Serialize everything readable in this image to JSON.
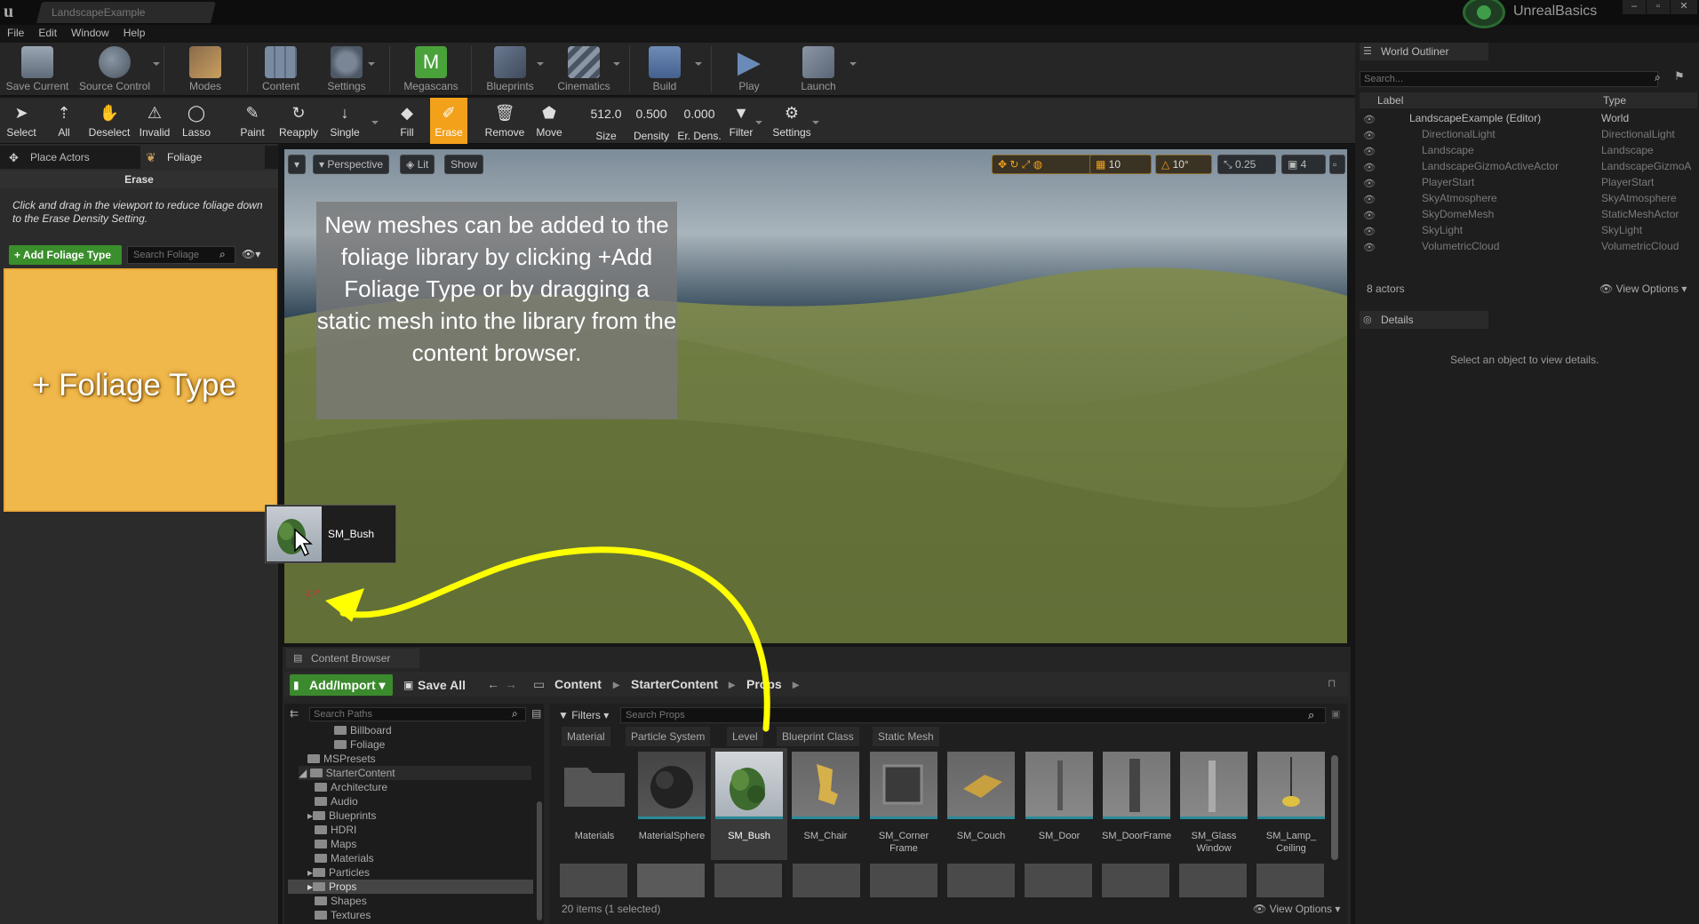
{
  "window": {
    "tab_title": "LandscapeExample",
    "project_name": "UnrealBasics"
  },
  "menu": [
    "File",
    "Edit",
    "Window",
    "Help"
  ],
  "main_toolbar": [
    {
      "label": "Save Current",
      "icon": "save-icon"
    },
    {
      "label": "Source Control",
      "icon": "source-control-icon"
    },
    {
      "label": "Modes",
      "icon": "modes-icon"
    },
    {
      "label": "Content",
      "icon": "content-icon"
    },
    {
      "label": "Settings",
      "icon": "settings-icon"
    },
    {
      "label": "Megascans",
      "icon": "megascans-icon"
    },
    {
      "label": "Blueprints",
      "icon": "blueprints-icon"
    },
    {
      "label": "Cinematics",
      "icon": "cinematics-icon"
    },
    {
      "label": "Build",
      "icon": "build-icon"
    },
    {
      "label": "Play",
      "icon": "play-icon"
    },
    {
      "label": "Launch",
      "icon": "launch-icon"
    }
  ],
  "tool_toolbar": {
    "tools": [
      "Select",
      "All",
      "Deselect",
      "Invalid",
      "Lasso",
      "Paint",
      "Reapply",
      "Single",
      "Fill",
      "Erase",
      "Remove",
      "Move"
    ],
    "active_tool": "Erase",
    "size": {
      "value": "512.0",
      "label": "Size"
    },
    "density": {
      "value": "0.500",
      "label": "Density"
    },
    "erase_density": {
      "value": "0.000",
      "label": "Er. Dens."
    },
    "filter_label": "Filter",
    "settings_label": "Settings"
  },
  "left_panel": {
    "tabs": [
      "Place Actors",
      "Foliage"
    ],
    "section_title": "Erase",
    "help_text": "Click and drag in the viewport to reduce foliage down to the Erase Density Setting.",
    "add_button": "+ Add Foliage Type",
    "search_placeholder": "Search Foliage",
    "drop_label": "+ Foliage Type"
  },
  "drag_ghost": {
    "name": "SM_Bush"
  },
  "viewport": {
    "view_mode": "Perspective",
    "lighting": "Lit",
    "show": "Show",
    "grid_snap": "10",
    "rotation_snap": "10°",
    "scale_snap": "0.25",
    "camera_speed": "4",
    "overlay_note": "New meshes can be added to the foliage library by clicking +Add Foliage Type or by dragging a static mesh into the library from the content browser."
  },
  "world_outliner": {
    "tab": "World Outliner",
    "search_placeholder": "Search...",
    "col_label": "Label",
    "col_type": "Type",
    "rows": [
      {
        "label": "LandscapeExample (Editor)",
        "type": "World"
      },
      {
        "label": "DirectionalLight",
        "type": "DirectionalLight"
      },
      {
        "label": "Landscape",
        "type": "Landscape"
      },
      {
        "label": "LandscapeGizmoActiveActor",
        "type": "LandscapeGizmoA"
      },
      {
        "label": "PlayerStart",
        "type": "PlayerStart"
      },
      {
        "label": "SkyAtmosphere",
        "type": "SkyAtmosphere"
      },
      {
        "label": "SkyDomeMesh",
        "type": "StaticMeshActor"
      },
      {
        "label": "SkyLight",
        "type": "SkyLight"
      },
      {
        "label": "VolumetricCloud",
        "type": "VolumetricCloud"
      }
    ],
    "count": "8 actors",
    "view_options": "View Options"
  },
  "details": {
    "tab": "Details",
    "empty_msg": "Select an object to view details."
  },
  "content_browser": {
    "tab": "Content Browser",
    "add_import": "Add/Import",
    "save_all": "Save All",
    "breadcrumb": [
      "Content",
      "StarterContent",
      "Props"
    ],
    "search_paths_placeholder": "Search Paths",
    "tree": [
      {
        "label": "Billboard"
      },
      {
        "label": "Foliage"
      },
      {
        "label": "MSPresets"
      },
      {
        "label": "StarterContent"
      },
      {
        "label": "Architecture"
      },
      {
        "label": "Audio"
      },
      {
        "label": "Blueprints"
      },
      {
        "label": "HDRI"
      },
      {
        "label": "Maps"
      },
      {
        "label": "Materials"
      },
      {
        "label": "Particles"
      },
      {
        "label": "Props"
      },
      {
        "label": "Shapes"
      },
      {
        "label": "Textures"
      }
    ],
    "filters_label": "Filters",
    "search_props_placeholder": "Search Props",
    "filter_chips": [
      "Material",
      "Particle System",
      "Level",
      "Blueprint Class",
      "Static Mesh"
    ],
    "assets": [
      {
        "name": "Materials"
      },
      {
        "name": "MaterialSphere"
      },
      {
        "name": "SM_Bush"
      },
      {
        "name": "SM_Chair"
      },
      {
        "name": "SM_Corner Frame"
      },
      {
        "name": "SM_Couch"
      },
      {
        "name": "SM_Door"
      },
      {
        "name": "SM_DoorFrame"
      },
      {
        "name": "SM_Glass Window"
      },
      {
        "name": "SM_Lamp_ Ceiling"
      }
    ],
    "selected_asset": "SM_Bush",
    "status": "20 items (1 selected)",
    "view_options": "View Options"
  },
  "colors": {
    "accent_orange": "#f3a11b",
    "foliage_drop": "#f0b84b",
    "green_button": "#3a8f2c",
    "annotation_arrow": "#ffff00"
  }
}
